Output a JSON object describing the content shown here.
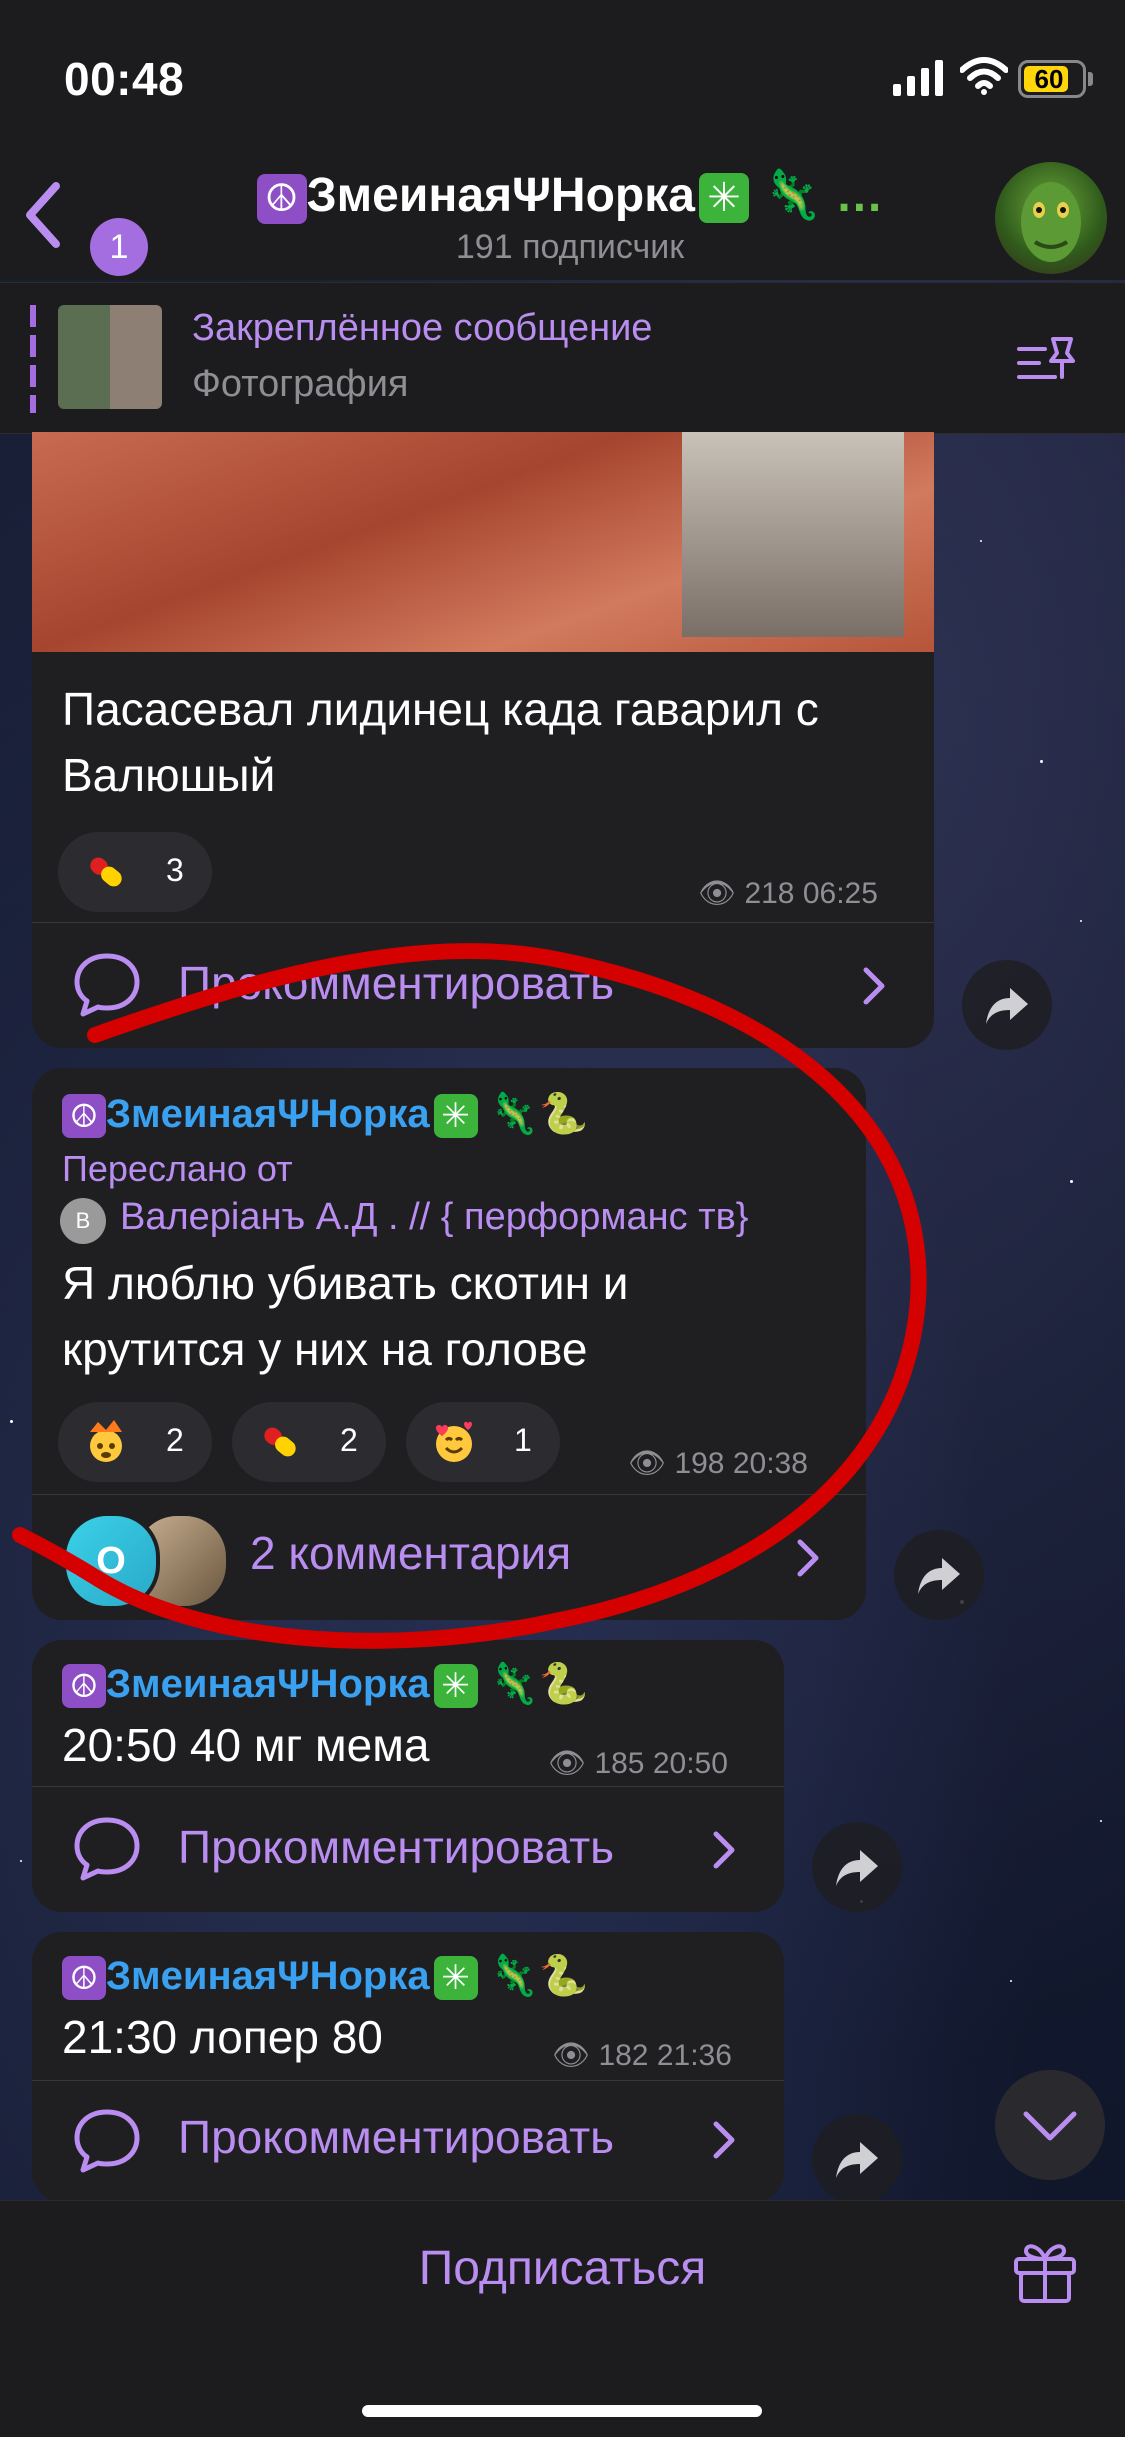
{
  "status_bar": {
    "time": "00:48",
    "battery": "60"
  },
  "header": {
    "back_count": "1",
    "channel_name": "ЗмеинаяΨНорка",
    "title_suffix": "🦎 …",
    "subscribers": "191 подписчик"
  },
  "pinned": {
    "title": "Закреплённое сообщение",
    "subtitle": "Фотография"
  },
  "messages": [
    {
      "text_line1": "Пасасевал лидинец када гаварил с",
      "text_line2": "Валюшый",
      "reactions": [
        {
          "icon": "pill-icon",
          "count": "3"
        }
      ],
      "views_time": "218 06:25",
      "comment_label": "Прокомментировать"
    },
    {
      "author": "ЗмеинаяΨНорка",
      "author_suffix": "🦎🐍",
      "forwarded_label": "Переслано от",
      "forwarded_initial": "В",
      "forwarded_from": "Валерiанъ А.Д . // { перформанс тв}",
      "text_line1": "Я люблю убивать скотин и",
      "text_line2": "крутится у них на голове",
      "reactions": [
        {
          "icon": "exploding-head-icon",
          "count": "2"
        },
        {
          "icon": "pill-icon",
          "count": "2"
        },
        {
          "icon": "smiling-hearts-icon",
          "count": "1"
        }
      ],
      "views_time": "198 20:38",
      "comment_avatar_letter": "О",
      "comment_label": "2 комментария"
    },
    {
      "author": "ЗмеинаяΨНорка",
      "author_suffix": "🦎🐍",
      "text": "20:50 40 мг мема",
      "views_time": "185 20:50",
      "comment_label": "Прокомментировать"
    },
    {
      "author": "ЗмеинаяΨНорка",
      "author_suffix": "🦎🐍",
      "text": "21:30 лопер 80",
      "views_time": "182 21:36",
      "comment_label": "Прокомментировать"
    }
  ],
  "bottom": {
    "subscribe_label": "Подписаться"
  },
  "colors": {
    "accent": "#b98ef0",
    "author": "#3aa0f0",
    "bubble": "#1f1f22",
    "annotation": "#d50000"
  }
}
